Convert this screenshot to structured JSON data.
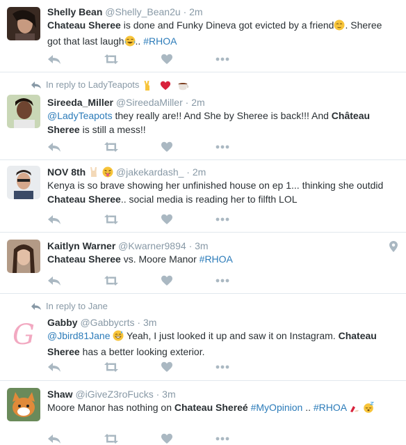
{
  "tweets": [
    {
      "name": "Shelly Bean",
      "handle": "@Shelly_Bean2u",
      "sep": "·",
      "time": "2m",
      "t1": "Chateau Sheree",
      "t2": " is done and Funky Dineva got evicted by a friend",
      "t3": ". Sheree got that last laugh",
      "t4": "..",
      "tag": "#RHOA"
    },
    {
      "reply_to": "In reply to LadyTeapots",
      "name": "Sireeda_Miller",
      "handle": "@SireedaMiller",
      "sep": "·",
      "time": "2m",
      "mention": "@LadyTeapots",
      "t1": " they really are!! And She by Sheree is back!!! And ",
      "t2": "Château Sheree",
      "t3": " is still a mess!!"
    },
    {
      "name": "NOV 8th",
      "handle": "@jakekardash_",
      "sep": "·",
      "time": "2m",
      "t1": "Kenya is so brave showing her unfinished house on ep 1... thinking she outdid ",
      "t2": "Chateau Sheree",
      "t3": ".. social media is reading her to filfth LOL"
    },
    {
      "name": "Kaitlyn Warner",
      "handle": "@Kwarner9894",
      "sep": "·",
      "time": "3m",
      "t1": "Chateau Sheree",
      "t2": " vs. Moore Manor ",
      "tag": "#RHOA"
    },
    {
      "reply_to": "In reply to Jane",
      "name": "Gabby",
      "handle": "@Gabbycrts",
      "sep": "·",
      "time": "3m",
      "mention": "@Jbird81Jane",
      "t1": " Yeah, I just looked it up and saw it on Instagram. ",
      "t2": "Chateau Sheree",
      "t3": " has a better looking exterior."
    },
    {
      "name": "Shaw",
      "handle": "@iGiveZ3roFucks",
      "sep": "·",
      "time": "3m",
      "t1": "Moore Manor has nothing on ",
      "t2": "Chateau Shereé",
      "t3": " ",
      "tag1": "#MyOpinion",
      "t4": " .. ",
      "tag2": "#RHOA"
    }
  ],
  "icons": {
    "reply": "reply-arrow-icon",
    "retweet": "retweet-icon",
    "like": "heart-icon",
    "more": "more-dots-icon",
    "geo": "location-pin-icon"
  },
  "colors": {
    "link": "#2b7bb9",
    "meta": "#8899a6",
    "icon": "#aab8c2",
    "divider": "#e1e8ed"
  }
}
